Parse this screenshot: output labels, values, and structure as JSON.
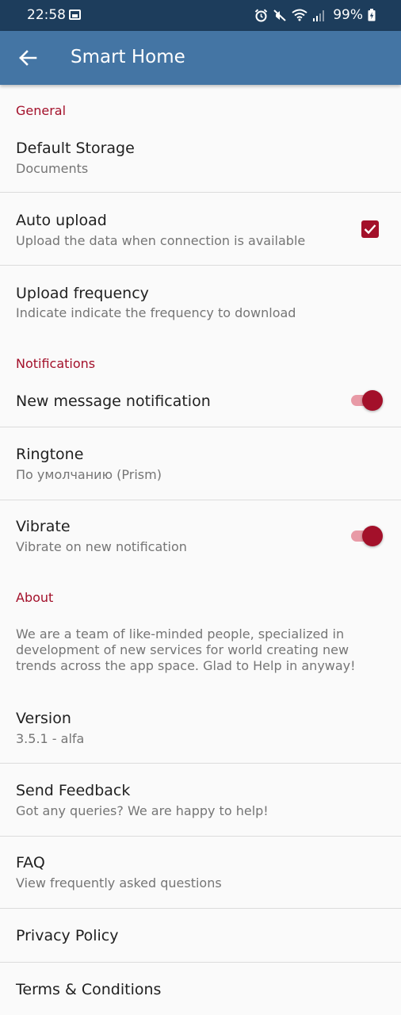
{
  "status_bar": {
    "time": "22:58",
    "battery": "99%"
  },
  "app_bar": {
    "title": "Smart Home"
  },
  "sections": {
    "general": "General",
    "notifications": "Notifications",
    "about": "About"
  },
  "prefs": {
    "default_storage": {
      "title": "Default Storage",
      "summary": "Documents"
    },
    "auto_upload": {
      "title": "Auto upload",
      "summary": "Upload the data when connection is available",
      "checked": true
    },
    "upload_frequency": {
      "title": "Upload frequency",
      "summary": "Indicate indicate the frequency to download"
    },
    "new_message": {
      "title": "New message notification",
      "on": true
    },
    "ringtone": {
      "title": "Ringtone",
      "summary": "По умолчанию (Prism)"
    },
    "vibrate": {
      "title": "Vibrate",
      "summary": "Vibrate on new notification",
      "on": true
    },
    "about_text": "We are a team of like-minded people, specialized in development of new services for world creating new trends across the app space. Glad to Help in anyway!",
    "version": {
      "title": "Version",
      "summary": "3.5.1 - alfa"
    },
    "send_feedback": {
      "title": "Send Feedback",
      "summary": "Got any queries? We are happy to help!"
    },
    "faq": {
      "title": "FAQ",
      "summary": "View frequently asked questions"
    },
    "privacy": {
      "title": "Privacy Policy"
    },
    "terms": {
      "title": "Terms & Conditions"
    }
  },
  "colors": {
    "accent": "#a3102a",
    "app_bar": "#4475a4",
    "status_bar": "#1d3d5c"
  }
}
